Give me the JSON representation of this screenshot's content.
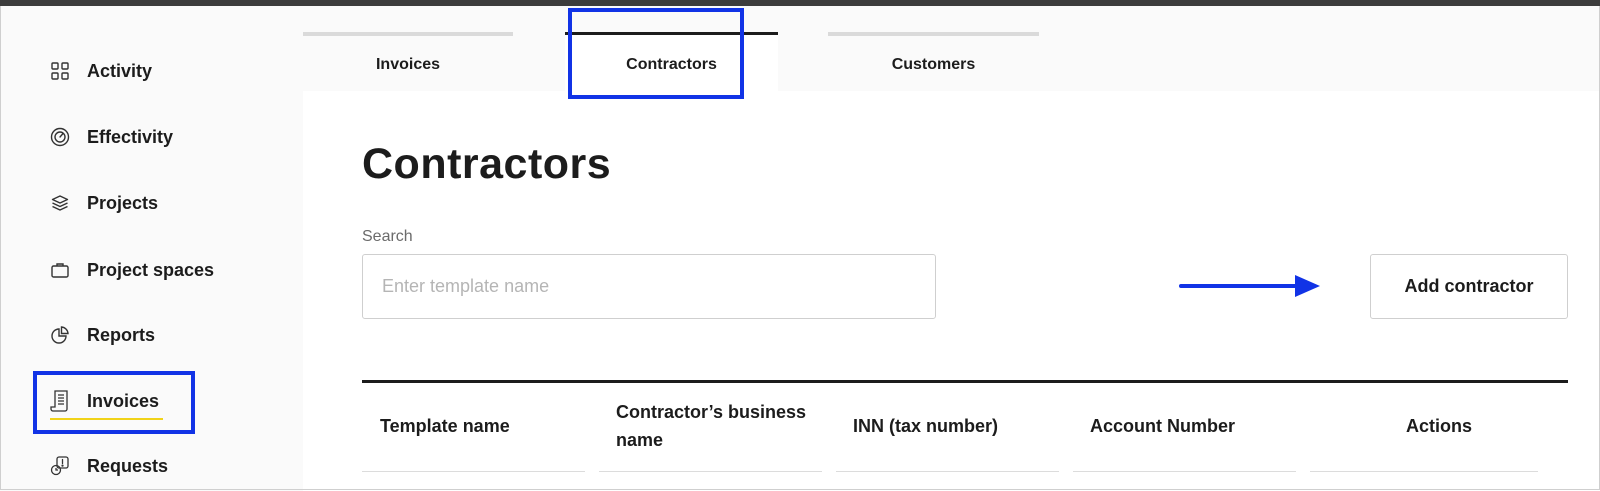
{
  "sidebar": {
    "items": [
      {
        "label": "Activity",
        "icon": "grid-icon"
      },
      {
        "label": "Effectivity",
        "icon": "gauge-icon"
      },
      {
        "label": "Projects",
        "icon": "layers-icon"
      },
      {
        "label": "Project spaces",
        "icon": "briefcase-icon"
      },
      {
        "label": "Reports",
        "icon": "pie-chart-icon"
      },
      {
        "label": "Invoices",
        "icon": "receipt-icon",
        "selected": true
      },
      {
        "label": "Requests",
        "icon": "request-icon"
      }
    ]
  },
  "tabs": [
    {
      "label": "Invoices",
      "active": false
    },
    {
      "label": "Contractors",
      "active": true
    },
    {
      "label": "Customers",
      "active": false
    }
  ],
  "main": {
    "title": "Contractors",
    "search": {
      "label": "Search",
      "placeholder": "Enter template name",
      "value": ""
    },
    "add_button": "Add contractor",
    "table": {
      "columns": [
        "Template name",
        "Contractor’s business name",
        "INN (tax number)",
        "Account Number",
        "Actions"
      ]
    }
  },
  "colors": {
    "highlight": "#1133e6",
    "selected_underline": "#f1d319",
    "text": "#1c1c1c"
  }
}
